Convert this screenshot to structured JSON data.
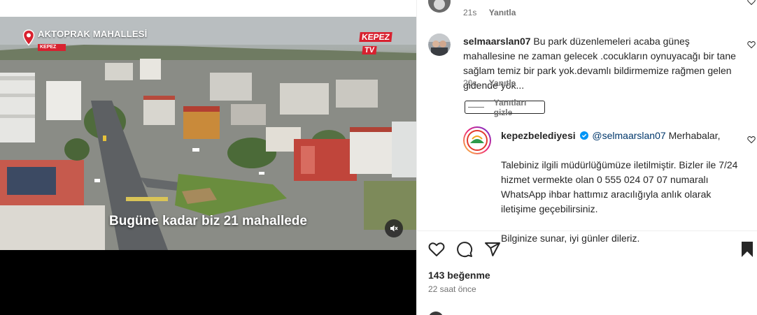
{
  "video": {
    "location_name": "AKTOPRAK MAHALLESİ",
    "location_sub": "KEPEZ",
    "brand_top": "KEPEZ",
    "brand_bottom": "TV",
    "caption": "Bugüne kadar biz 21 mahallede",
    "muted": true
  },
  "comments": [
    {
      "username": "",
      "text": "",
      "time": "21s",
      "reply_label": "Yanıtla"
    },
    {
      "username": "selmaarslan07",
      "text": "Bu park düzenlemeleri acaba güneş mahallesine ne zaman gelecek .cocukların oynuyacağı bir tane sağlam temiz bir park yok.devamlı bildirmemize rağmen gelen gidende yok...",
      "time": "20s",
      "reply_label": "Yanıtla",
      "hide_replies_label": "Yanıtları gizle"
    }
  ],
  "reply": {
    "username": "kepezbelediyesi",
    "mention": "@selmaarslan07",
    "greeting": "Merhabalar,",
    "paragraph1": "Talebiniz ilgili müdürlüğümüze iletilmiştir. Bizler ile 7/24 hizmet vermekte olan 0 555 024 07 07 numaralı WhatsApp ihbar hattımız aracılığıyla anlık olarak iletişime geçebilirsiniz.",
    "paragraph2": "Bilginize sunar, iyi günler dileriz."
  },
  "post": {
    "likes": "143 beğenme",
    "time_ago": "22 saat önce"
  },
  "icons": {
    "like": "heart-icon",
    "comment": "comment-icon",
    "share": "share-icon",
    "save": "bookmark-filled-icon",
    "verified": "verified-badge-icon",
    "mute": "speaker-muted-icon",
    "location": "location-pin-icon"
  },
  "colors": {
    "brand_red": "#d8212f",
    "verified_blue": "#0095f6",
    "mention": "#00376b",
    "meta_gray": "#737373"
  }
}
